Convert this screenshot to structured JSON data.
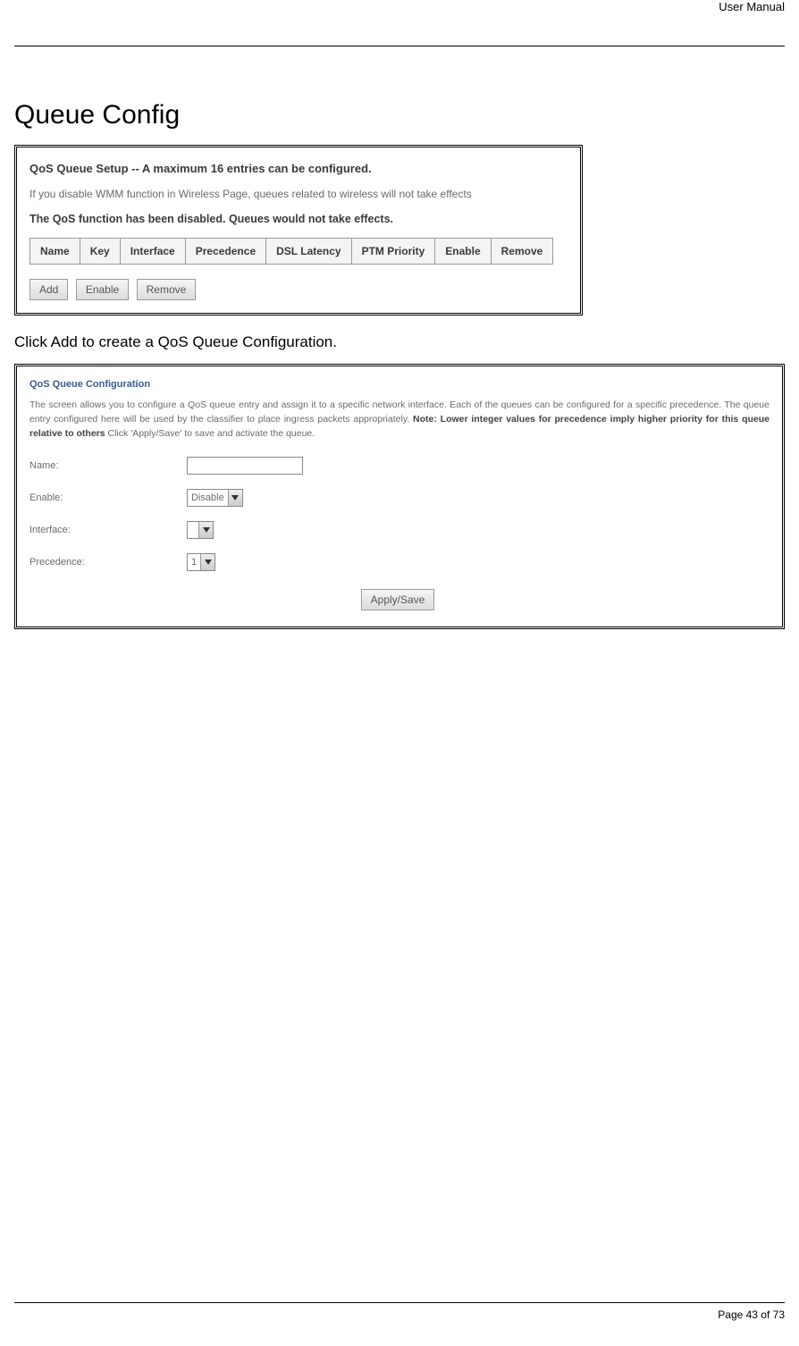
{
  "header": {
    "doc_title": "User Manual"
  },
  "section": {
    "title": "Queue Config"
  },
  "panel_setup": {
    "title": "QoS Queue Setup -- A maximum 16 entries can be configured.",
    "note": "If you disable WMM function in Wireless Page, queues related to wireless will not take effects",
    "status": "The QoS function has been disabled. Queues would not take effects.",
    "columns": [
      "Name",
      "Key",
      "Interface",
      "Precedence",
      "DSL Latency",
      "PTM Priority",
      "Enable",
      "Remove"
    ],
    "buttons": {
      "add": "Add",
      "enable": "Enable",
      "remove": "Remove"
    }
  },
  "instruction": "Click Add to create a QoS Queue Configuration.",
  "panel_config": {
    "title": "QoS Queue Configuration",
    "desc_pre": "The screen allows you to configure a QoS queue entry and assign it to a specific network interface. Each of the queues can be configured for a specific precedence. The queue entry configured here will be used by the classifier to place ingress packets appropriately. ",
    "desc_bold": "Note: Lower integer values for precedence imply higher priority for this queue relative to others",
    "desc_post": " Click 'Apply/Save' to save and activate the queue.",
    "fields": {
      "name": {
        "label": "Name:",
        "value": ""
      },
      "enable": {
        "label": "Enable:",
        "value": "Disable"
      },
      "interface": {
        "label": "Interface:",
        "value": ""
      },
      "precedence": {
        "label": "Precedence:",
        "value": "1"
      }
    },
    "apply_label": "Apply/Save"
  },
  "footer": {
    "page_label": "Page 43 of 73"
  }
}
